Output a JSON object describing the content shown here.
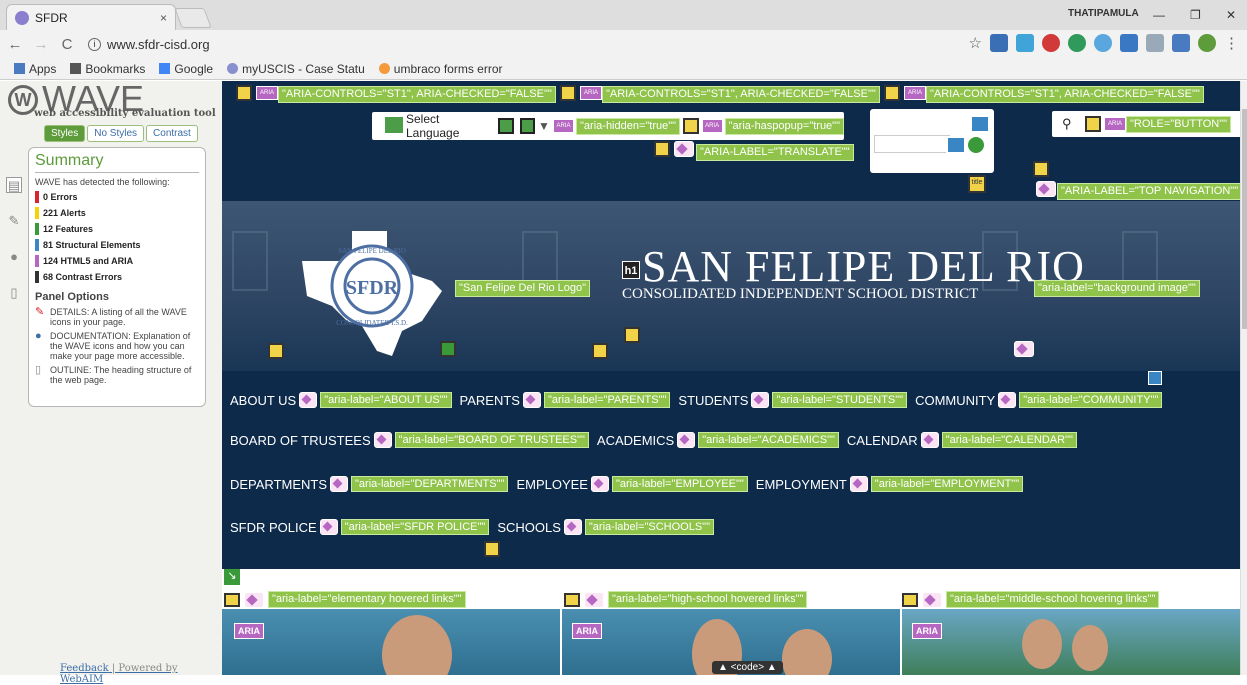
{
  "browser": {
    "tab_title": "SFDR",
    "tab_close": "×",
    "window_user": "THATIPAMULA",
    "window_min": "—",
    "window_restore": "❐",
    "window_close": "✕",
    "back": "←",
    "forward": "→",
    "reload": "C",
    "url": "www.sfdr-cisd.org",
    "star": "☆",
    "menu": "⋮"
  },
  "bookmarks": [
    {
      "label": "Apps",
      "icon": "apps-icon"
    },
    {
      "label": "Bookmarks",
      "icon": "star-icon"
    },
    {
      "label": "Google",
      "icon": "google-icon"
    },
    {
      "label": "myUSCIS - Case Statu",
      "icon": "uscis-icon"
    },
    {
      "label": "umbraco forms error",
      "icon": "umbraco-icon"
    }
  ],
  "wave": {
    "title": "WAVE",
    "subtitle": "web accessibility evaluation tool",
    "tabs": [
      "Styles",
      "No Styles",
      "Contrast"
    ],
    "summary_heading": "Summary",
    "detected_text": "WAVE has detected the following:",
    "counts": [
      {
        "label": "0 Errors",
        "color": "#d9232e"
      },
      {
        "label": "221 Alerts",
        "color": "#f5d10a"
      },
      {
        "label": "12 Features",
        "color": "#3a9a3a"
      },
      {
        "label": "81 Structural Elements",
        "color": "#3b86c5"
      },
      {
        "label": "124 HTML5 and ARIA",
        "color": "#b667c1"
      },
      {
        "label": "68 Contrast Errors",
        "color": "#333333"
      }
    ],
    "panel_options_heading": "Panel Options",
    "options": [
      {
        "icon": "pin-icon",
        "text": "DETAILS: A listing of all the WAVE icons in your page."
      },
      {
        "icon": "info-icon",
        "text": "DOCUMENTATION: Explanation of the WAVE icons and how you can make your page more accessible."
      },
      {
        "icon": "outline-icon",
        "text": "OUTLINE: The heading structure of the web page."
      }
    ],
    "feedback": "Feedback",
    "separator": " | Powered by ",
    "webaim": "WebAIM"
  },
  "site": {
    "aria_controls": "\"ARIA-CONTROLS=\"ST1\", ARIA-CHECKED=\"FALSE\"\"",
    "select_language": "Select Language",
    "aria_hidden": "\"aria-hidden=\"true\"\"",
    "aria_haspopup": "\"aria-haspopup=\"true\"\"",
    "aria_translate": "\"ARIA-LABEL=\"TRANSLATE\"\"",
    "role_button": "\"ROLE=\"BUTTON\"\"",
    "top_navigation": "\"ARIA-LABEL=\"TOP NAVIGATION\"\"",
    "title_tag": "title",
    "logo_label": "\"San Felipe Del Rio Logo\"",
    "bg_label": "\"aria-label=\"background image\"\"",
    "h1": "h1",
    "district_name": "SAN FELIPE DEL RIO",
    "district_sub": "CONSOLIDATED INDEPENDENT SCHOOL DISTRICT",
    "logo_text_top": "SAN FELIPE DEL RIO",
    "logo_text_mid": "SFDR",
    "logo_text_bot": "CONSOLIDATED I.S.D.",
    "nav_rows": [
      [
        {
          "label": "ABOUT US",
          "aria": "\"aria-label=\"ABOUT US\"\""
        },
        {
          "label": "PARENTS",
          "aria": "\"aria-label=\"PARENTS\"\""
        },
        {
          "label": "STUDENTS",
          "aria": "\"aria-label=\"STUDENTS\"\""
        },
        {
          "label": "COMMUNITY",
          "aria": "\"aria-label=\"COMMUNITY\"\""
        }
      ],
      [
        {
          "label": "BOARD OF TRUSTEES",
          "aria": "\"aria-label=\"BOARD OF TRUSTEES\"\""
        },
        {
          "label": "ACADEMICS",
          "aria": "\"aria-label=\"ACADEMICS\"\""
        },
        {
          "label": "CALENDAR",
          "aria": "\"aria-label=\"CALENDAR\"\""
        }
      ],
      [
        {
          "label": "DEPARTMENTS",
          "aria": "\"aria-label=\"DEPARTMENTS\"\""
        },
        {
          "label": "EMPLOYEE",
          "aria": "\"aria-label=\"EMPLOYEE\"\""
        },
        {
          "label": "EMPLOYMENT",
          "aria": "\"aria-label=\"EMPLOYMENT\"\""
        }
      ],
      [
        {
          "label": "SFDR POLICE",
          "aria": "\"aria-label=\"SFDR POLICE\"\""
        },
        {
          "label": "SCHOOLS",
          "aria": "\"aria-label=\"SCHOOLS\"\""
        }
      ]
    ],
    "hover_labels": [
      "\"aria-label=\"elementary hovered links\"\"",
      "\"aria-label=\"high-school hovered links\"\"",
      "\"aria-label=\"middle-school hovering links\"\""
    ],
    "aria_badge": "ARIA",
    "code_tag": "▲ <code> ▲"
  }
}
